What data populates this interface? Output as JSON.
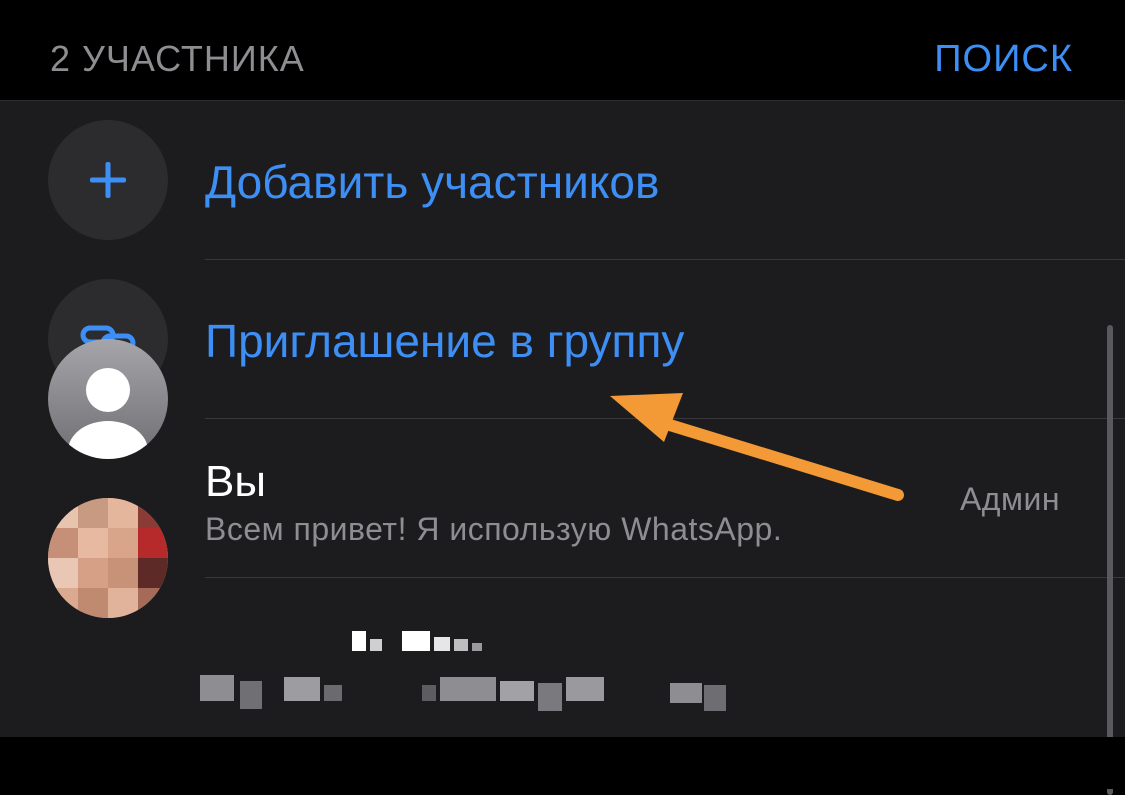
{
  "header": {
    "participants_count": "2 УЧАСТНИКА",
    "search_label": "ПОИСК"
  },
  "actions": {
    "add_participants": {
      "label": "Добавить участников",
      "icon": "plus-icon"
    },
    "invite_link": {
      "label": "Приглашение в группу",
      "icon": "link-icon"
    }
  },
  "members": [
    {
      "name": "Вы",
      "status": "Всем привет! Я использую WhatsApp.",
      "role": "Админ",
      "avatar": "default-person-icon"
    },
    {
      "name": "",
      "status": "",
      "avatar": "pixelated-photo",
      "pixelated": true
    }
  ],
  "annotation": {
    "arrow_color": "#f39a36",
    "points_to": "invite_link"
  },
  "colors": {
    "accent": "#3d8ff5",
    "background": "#000000",
    "list_background": "#1c1c1e",
    "secondary_text": "#8d8d92"
  }
}
